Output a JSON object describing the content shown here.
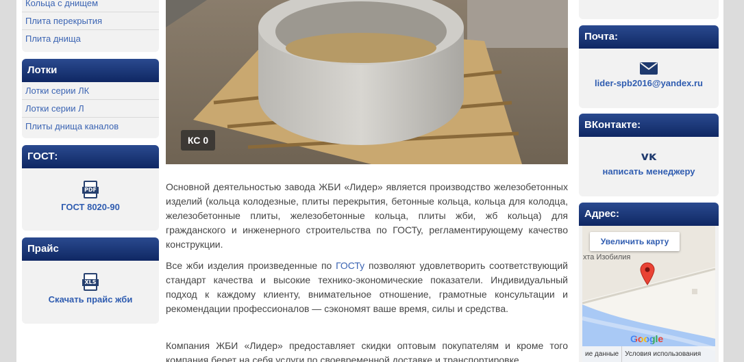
{
  "left": {
    "top_links": [
      "Кольца с днищем",
      "Плита перекрытия",
      "Плита днища"
    ],
    "trays": {
      "title": "Лотки",
      "items": [
        "Лотки серии ЛК",
        "Лотки серии Л",
        "Плиты днища каналов"
      ]
    },
    "gost": {
      "title": "ГОСТ:",
      "icon_label": "PDF",
      "link": "ГОСТ 8020-90"
    },
    "price": {
      "title": "Прайс",
      "icon_label": "XLS",
      "link": "Скачать прайс жби"
    }
  },
  "main": {
    "caption": "КС 0",
    "p1": "Основной деятельностью завода ЖБИ «Лидер» является производство железобетонных изделий (кольца колодезные, плиты перекрытия, бетонные кольца, кольца для колодца, железобетонные плиты, железобетонные кольца, плиты жби, жб кольца) для гражданского и инженерного строительства по ГОСТу, регламентирующему качество конструкции.",
    "p2_before": "Все жби изделия произведенные по ",
    "p2_link": "ГОСТу",
    "p2_after": " позволяют удовлетворить соответствующий стандарт качества и высокие технико-экономические показатели. Индивидуальный подход к каждому клиенту, внимательное отношение, грамотные консультации и рекомендации профессионалов — сэкономят ваше время, силы и средства.",
    "p3": "Компания ЖБИ «Лидер» предоставляет скидки оптовым покупателям и кроме того компания берет на себя услуги по своевременной доставке и транспортировке"
  },
  "right": {
    "mail": {
      "title": "Почта:",
      "email": "lider-spb2016@yandex.ru"
    },
    "vk": {
      "title": "ВКонтакте:",
      "link": "написать менеджеру"
    },
    "address": {
      "title": "Адрес:",
      "zoom_button": "Увеличить карту",
      "street": "хта Изобилия",
      "google": "Google",
      "footer_left": "ие данные",
      "footer_right": "Условия использования"
    }
  }
}
